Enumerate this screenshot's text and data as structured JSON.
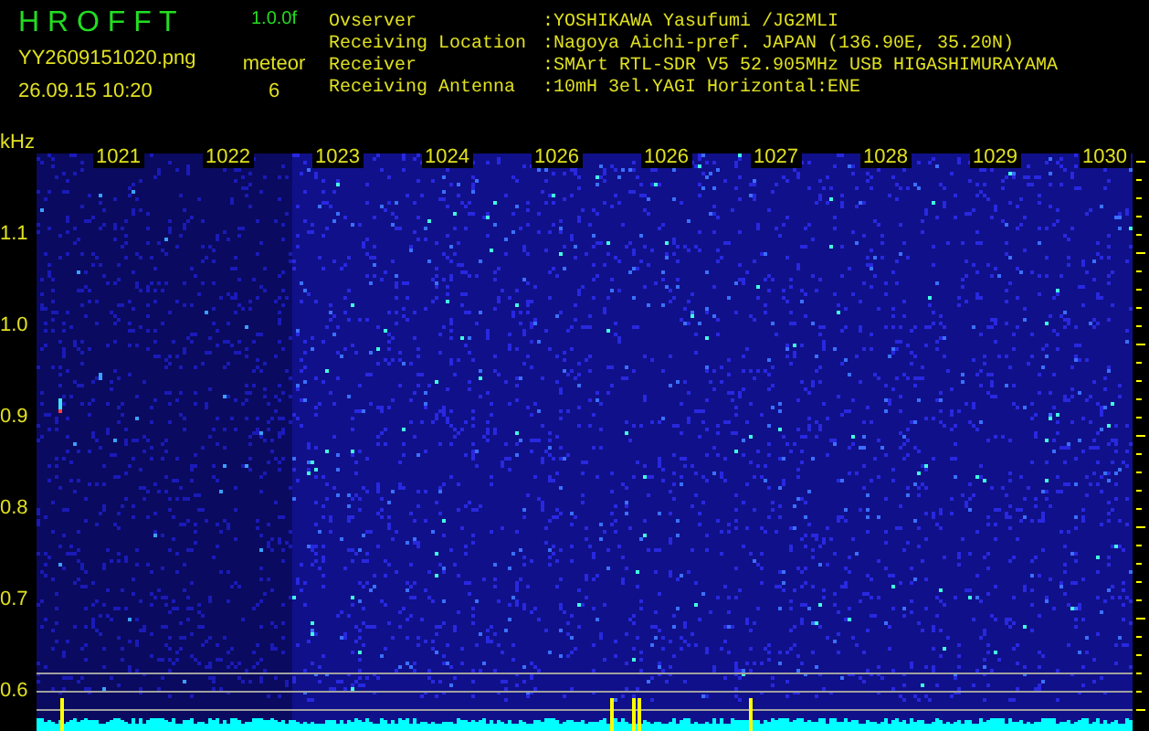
{
  "app": {
    "title": "H R O F F T",
    "version": "1.0.0f",
    "filename": "YY2609151020.png",
    "datetime": "26.09.15 10:20",
    "mode": "meteor",
    "count": "6"
  },
  "station": [
    {
      "label": "Ovserver",
      "value": ":YOSHIKAWA Yasufumi /JG2MLI"
    },
    {
      "label": "Receiving Location",
      "value": ":Nagoya Aichi-pref. JAPAN (136.90E, 35.20N)"
    },
    {
      "label": "Receiver",
      "value": ":SMArt RTL-SDR V5 52.905MHz USB HIGASHIMURAYAMA"
    },
    {
      "label": "Receiving Antenna",
      "value": ":10mH 3el.YAGI Horizontal:ENE"
    }
  ],
  "spectrogram": {
    "unit": "kHz",
    "freq_labels": [
      "1021",
      "1022",
      "1023",
      "1024",
      "1026",
      "1026",
      "1027",
      "1028",
      "1029",
      "1030"
    ],
    "time_labels": [
      "1.1",
      "1.0",
      "0.9",
      "0.8",
      "0.7",
      "0.6"
    ]
  }
}
